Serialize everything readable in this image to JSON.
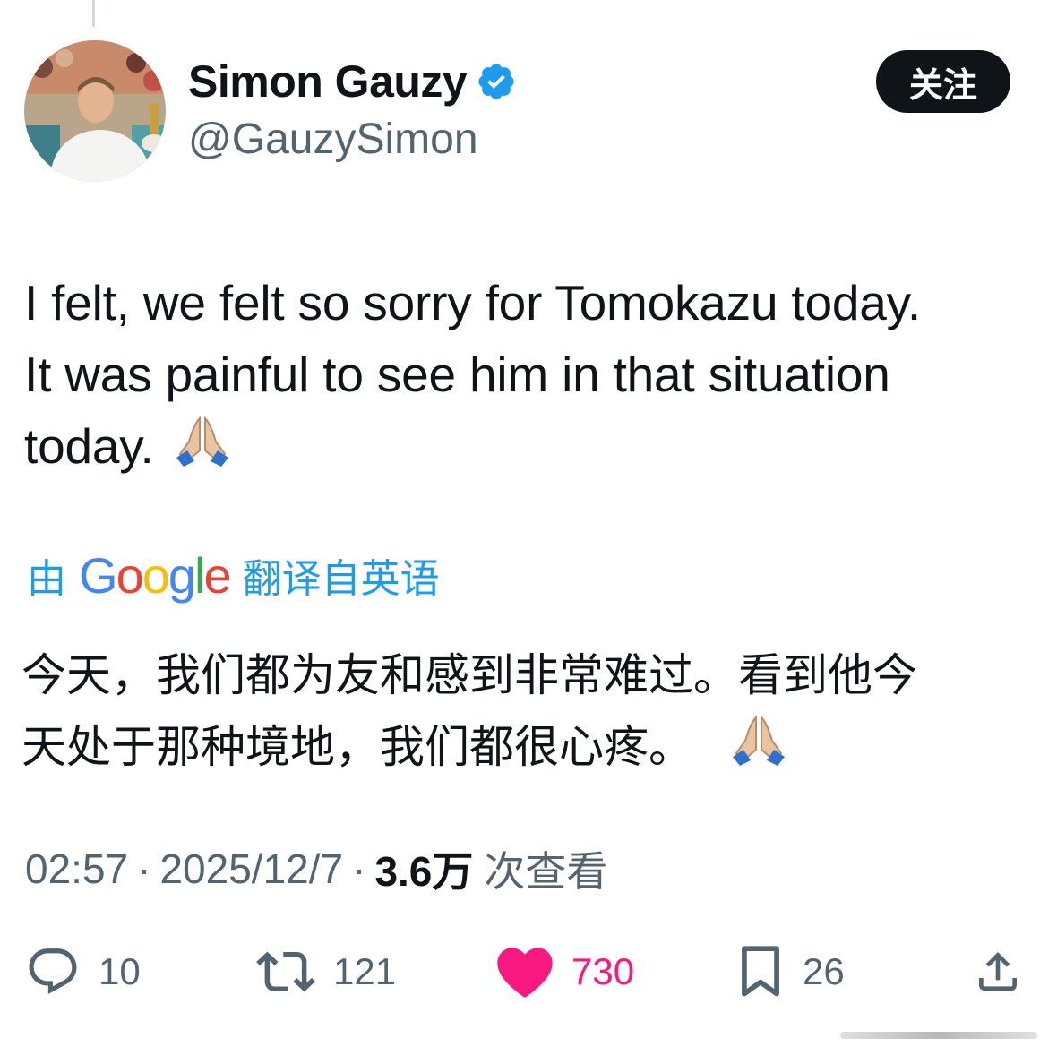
{
  "author": {
    "display_name": "Simon Gauzy",
    "handle": "@GauzySimon",
    "verified": true,
    "verified_color": "#1d9bf0"
  },
  "follow_button": {
    "label": "关注"
  },
  "tweet": {
    "lines": [
      "I felt, we felt so sorry for Tomokazu today.",
      "It was painful to see him in that situation",
      "today."
    ],
    "emoji": "folded-hands"
  },
  "translation": {
    "prefix": "由",
    "brand": [
      "G",
      "o",
      "o",
      "g",
      "l",
      "e"
    ],
    "brand_colors": [
      "#4285f4",
      "#ea4335",
      "#fbbc05",
      "#4285f4",
      "#34a853",
      "#ea4335"
    ],
    "suffix": "翻译自英语",
    "lines": [
      "今天，我们都为友和感到非常难过。看到他今",
      "天处于那种境地，我们都很心疼。"
    ]
  },
  "meta": {
    "time": "02:57",
    "date": "2025/12/7",
    "views": "3.6万",
    "views_label": "次查看",
    "separator": "·"
  },
  "actions": {
    "reply": {
      "icon": "reply-icon",
      "count": "10"
    },
    "retweet": {
      "icon": "retweet-icon",
      "count": "121"
    },
    "like": {
      "icon": "heart-icon",
      "count": "730",
      "color": "#f91880"
    },
    "bookmark": {
      "icon": "bookmark-icon",
      "count": "26"
    },
    "share": {
      "icon": "share-icon"
    }
  }
}
